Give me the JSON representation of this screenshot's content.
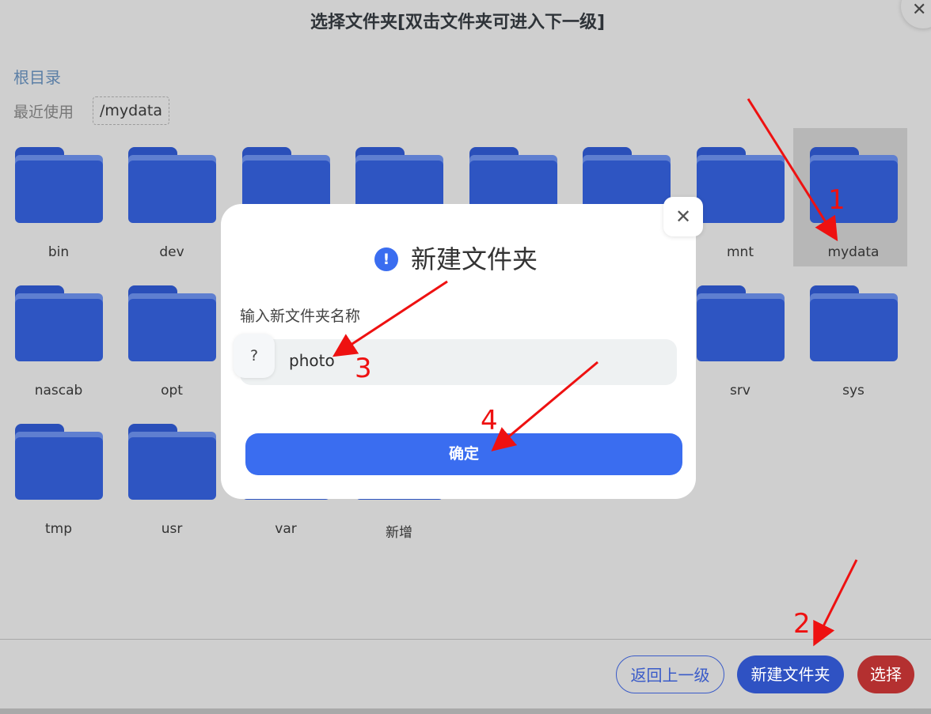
{
  "dialog": {
    "title": "选择文件夹[双击文件夹可进入下一级]",
    "close_glyph": "✕",
    "root_link": "根目录",
    "recent_label": "最近使用",
    "recent_path": "/mydata"
  },
  "folders": [
    {
      "label": "bin"
    },
    {
      "label": "dev"
    },
    {
      "label": ""
    },
    {
      "label": ""
    },
    {
      "label": ""
    },
    {
      "label": ""
    },
    {
      "label": "mnt"
    },
    {
      "label": "mydata",
      "selected": true
    },
    {
      "label": "nascab"
    },
    {
      "label": "opt"
    },
    {
      "label": ""
    },
    {
      "label": ""
    },
    {
      "label": ""
    },
    {
      "label": ""
    },
    {
      "label": "srv"
    },
    {
      "label": "sys"
    },
    {
      "label": "tmp"
    },
    {
      "label": "usr"
    },
    {
      "label": "var"
    },
    {
      "label": "新增"
    }
  ],
  "footer": {
    "back_label": "返回上一级",
    "new_folder_label": "新建文件夹",
    "select_label": "选择"
  },
  "modal": {
    "close_glyph": "✕",
    "info_glyph": "!",
    "title": "新建文件夹",
    "field_label": "输入新文件夹名称",
    "input_prefix": "?",
    "input_value": "photo",
    "confirm_label": "确定"
  },
  "annotations": {
    "step1": "1",
    "step2": "2",
    "step3": "3",
    "step4": "4",
    "color": "#ee1111"
  },
  "colors": {
    "folder": "#2e55c2",
    "primary": "#3a6df0",
    "danger": "#b43030",
    "overlay": "#cfcfcf"
  }
}
